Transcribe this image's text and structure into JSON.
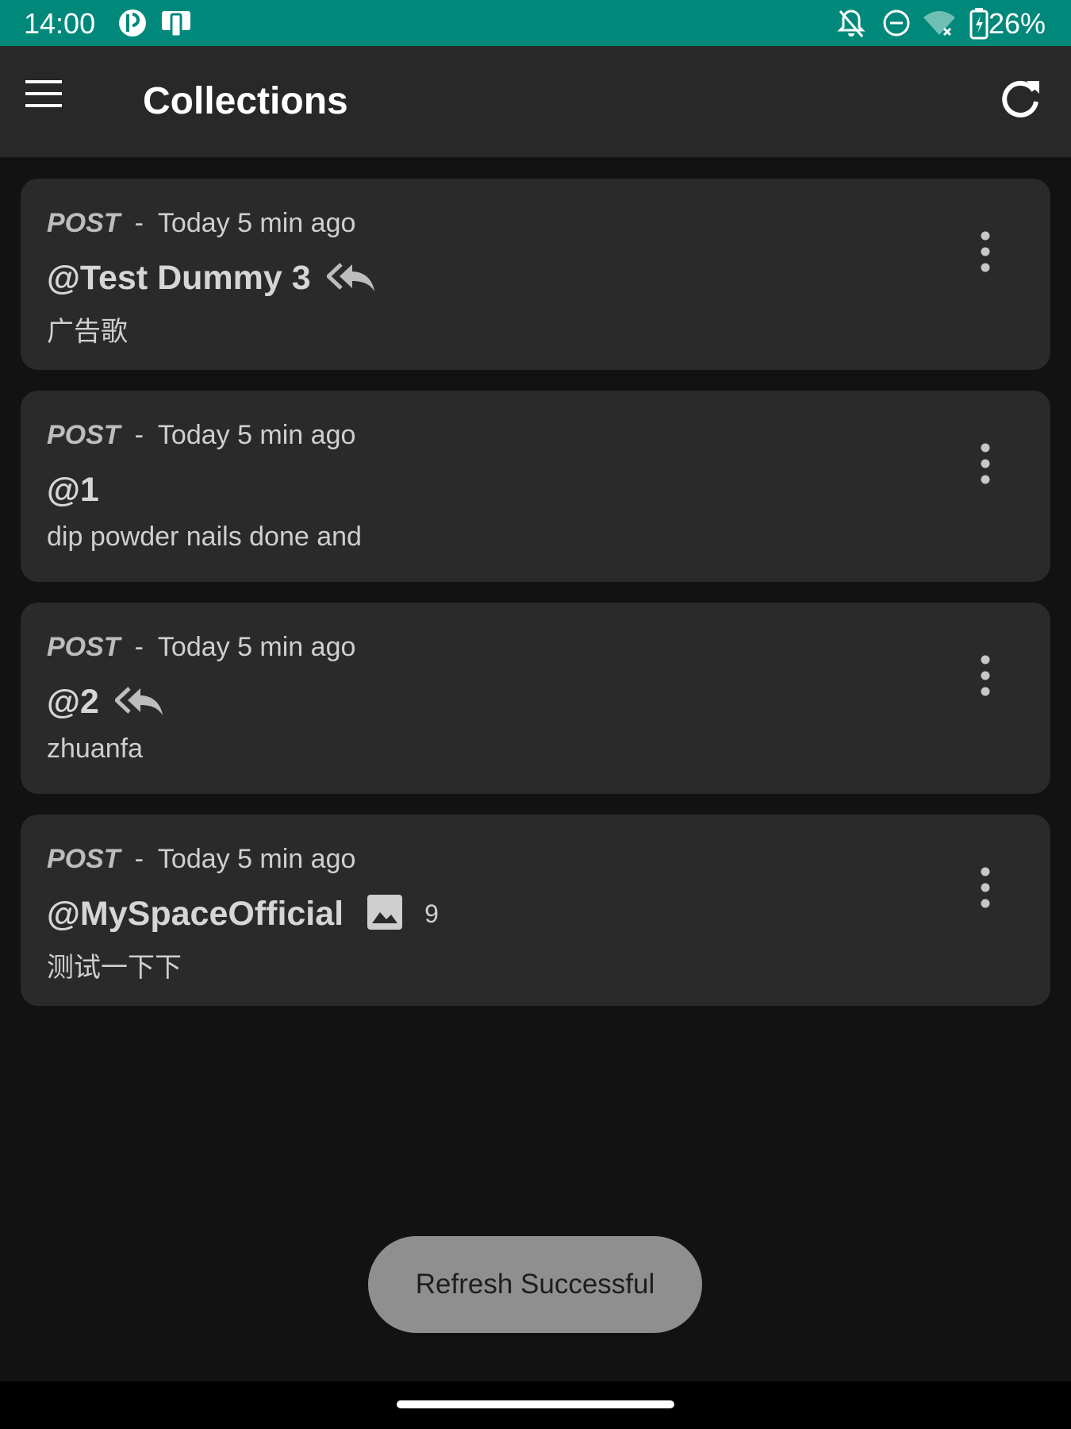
{
  "status_bar": {
    "time": "14:00",
    "battery_percent": "26%",
    "icons": [
      "app-notification-icon",
      "device-icon",
      "notifications-off-icon",
      "do-not-disturb-icon",
      "wifi-off-icon",
      "battery-charging-icon"
    ]
  },
  "app_bar": {
    "title": "Collections",
    "menu_icon": "hamburger-menu-icon",
    "refresh_icon": "refresh-icon"
  },
  "posts": [
    {
      "type": "POST",
      "separator": "-",
      "time": "Today 5 min ago",
      "author": "@Test Dummy 3",
      "has_repost_icon": true,
      "text": "广告歌"
    },
    {
      "type": "POST",
      "separator": "-",
      "time": "Today 5 min ago",
      "author": "@1",
      "has_repost_icon": false,
      "text": "dip powder nails done and"
    },
    {
      "type": "POST",
      "separator": "-",
      "time": "Today 5 min ago",
      "author": "@2",
      "has_repost_icon": true,
      "text": "zhuanfa"
    },
    {
      "type": "POST",
      "separator": "-",
      "time": "Today 5 min ago",
      "author": "@MySpaceOfficial",
      "has_image_icon": true,
      "image_count": "9",
      "text": "测试一下下"
    }
  ],
  "toast": {
    "message": "Refresh Successful"
  },
  "colors": {
    "status_bar": "#00897b",
    "app_bar": "#282828",
    "background": "#121212",
    "card": "#2a2a2b",
    "toast": "#8f8f8f"
  }
}
